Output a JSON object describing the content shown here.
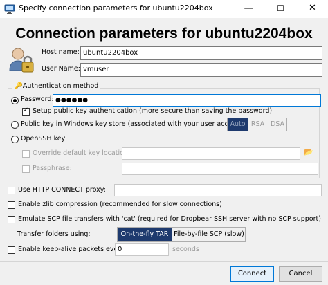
{
  "window": {
    "title": "Specify connection parameters for ubuntu2204box",
    "minimize_glyph": "—",
    "maximize_glyph": "☐",
    "close_glyph": "✕"
  },
  "heading": "Connection parameters for ubuntu2204box",
  "host": {
    "label": "Host name:",
    "value": "ubuntu2204box"
  },
  "user": {
    "label": "User Name:",
    "value": "vmuser"
  },
  "auth": {
    "legend": "Authentication method",
    "password_label": "Password:",
    "password_value": "●●●●●●",
    "setup_pubkey_label": "Setup public key authentication (more secure than saving the password)",
    "pubkey_label": "Public key in Windows key store (associated with your user account):",
    "key_types": [
      "Auto",
      "RSA",
      "DSA"
    ],
    "openssh_label": "OpenSSH key",
    "override_key_label": "Override default key location:",
    "browse_glyph": "📂",
    "passphrase_label": "Passphrase:"
  },
  "proxy_label": "Use HTTP CONNECT proxy:",
  "zlib_label": "Enable zlib compression (recommended for slow connections)",
  "scp_label": "Emulate SCP file transfers with 'cat' (required for Dropbear SSH server with no SCP support)",
  "transfer": {
    "label": "Transfer folders using:",
    "options": [
      "On-the-fly TAR",
      "File-by-file SCP (slow)"
    ]
  },
  "keepalive": {
    "label": "Enable keep-alive packets every:",
    "value": "0",
    "unit": "seconds"
  },
  "buttons": {
    "connect": "Connect",
    "cancel": "Cancel"
  },
  "colors": {
    "accent": "#0078d7",
    "selected_segment": "#1e3a6e",
    "background": "#f0f0f0"
  }
}
